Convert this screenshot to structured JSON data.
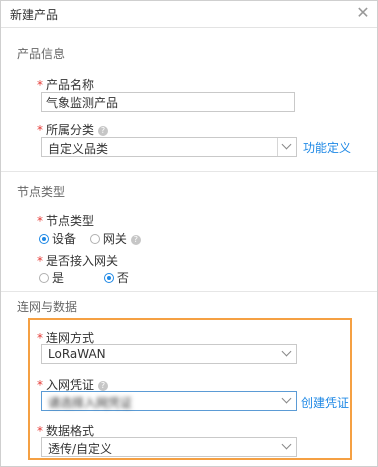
{
  "dialog": {
    "title": "新建产品",
    "close_icon": "close-icon"
  },
  "sections": {
    "product_info": "产品信息",
    "node_type": "节点类型",
    "network_data": "连网与数据"
  },
  "fields": {
    "product_name": {
      "label": "产品名称",
      "value": "气象监测产品"
    },
    "category": {
      "label": "所属分类",
      "value": "自定义品类",
      "link": "功能定义"
    },
    "node_type": {
      "label": "节点类型",
      "options": [
        "设备",
        "网关"
      ],
      "selected": "设备"
    },
    "gateway_access": {
      "label": "是否接入网关",
      "options": [
        "是",
        "否"
      ],
      "selected": "否"
    },
    "network_mode": {
      "label": "连网方式",
      "value": "LoRaWAN"
    },
    "network_credential": {
      "label": "入网凭证",
      "value": "请选择入网凭证",
      "link": "创建凭证"
    },
    "data_format": {
      "label": "数据格式",
      "value": "透传/自定义"
    }
  },
  "colors": {
    "accent": "#1e88e5",
    "required": "#e53935",
    "highlight": "#f5a043"
  }
}
